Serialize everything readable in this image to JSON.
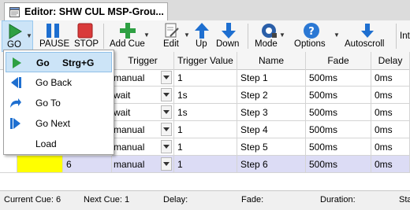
{
  "window": {
    "tab_title": "Editor: SHW CUL MSP-Grou..."
  },
  "toolbar": {
    "go": "GO",
    "pause": "PAUSE",
    "stop": "STOP",
    "add_cue": "Add Cue",
    "edit": "Edit",
    "up": "Up",
    "down": "Down",
    "mode": "Mode",
    "options": "Options",
    "autoscroll": "Autoscroll",
    "overflow": "Int"
  },
  "go_menu": {
    "items": [
      {
        "label": "Go",
        "shortcut": "Strg+G"
      },
      {
        "label": "Go Back"
      },
      {
        "label": "Go To"
      },
      {
        "label": "Go Next"
      },
      {
        "label": "Load"
      }
    ]
  },
  "grid": {
    "headers": [
      "Trigger",
      "Trigger Value",
      "Name",
      "Fade",
      "Delay"
    ],
    "rows": [
      {
        "trigger": "manual",
        "trigger_value": "1",
        "name": "Step 1",
        "fade": "500ms",
        "delay": "0ms"
      },
      {
        "trigger": "wait",
        "trigger_value": "1s",
        "name": "Step 2",
        "fade": "500ms",
        "delay": "0ms"
      },
      {
        "trigger": "wait",
        "trigger_value": "1s",
        "name": "Step 3",
        "fade": "500ms",
        "delay": "0ms"
      },
      {
        "trigger": "manual",
        "trigger_value": "1",
        "name": "Step 4",
        "fade": "500ms",
        "delay": "0ms"
      },
      {
        "trigger": "manual",
        "trigger_value": "1",
        "name": "Step 5",
        "fade": "500ms",
        "delay": "0ms"
      },
      {
        "number": "6",
        "color": "#ffff00",
        "trigger": "manual",
        "trigger_value": "1",
        "name": "Step 6",
        "fade": "500ms",
        "delay": "0ms"
      }
    ]
  },
  "status": {
    "current_cue": "Current Cue: 6",
    "next_cue": "Next Cue: 1",
    "delay": "Delay:",
    "fade": "Fade:",
    "duration": "Duration:",
    "overflow": "Sta"
  }
}
